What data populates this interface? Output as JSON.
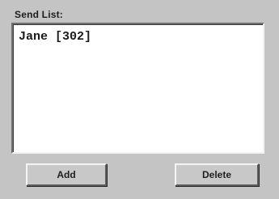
{
  "send_list": {
    "title": "Send List:",
    "items": [
      "Jane [302]"
    ]
  },
  "buttons": {
    "add_label": "Add",
    "delete_label": "Delete"
  }
}
